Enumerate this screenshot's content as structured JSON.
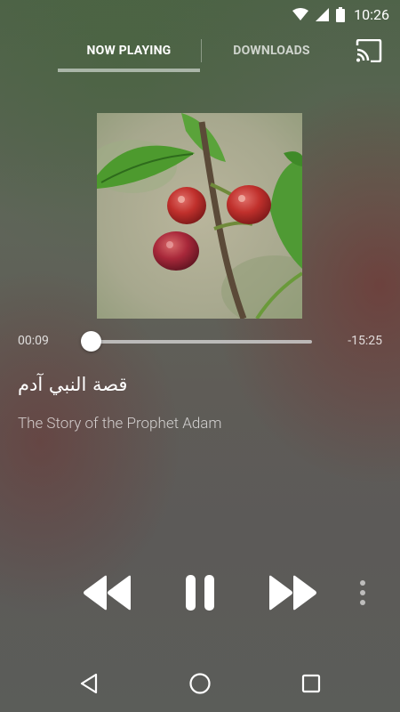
{
  "status_bar": {
    "time": "10:26",
    "icons": [
      "wifi-icon",
      "cell-signal-icon",
      "battery-icon"
    ]
  },
  "tabs": [
    {
      "label": "NOW PLAYING",
      "active": true
    },
    {
      "label": "DOWNLOADS",
      "active": false
    }
  ],
  "header": {
    "cast_icon": "cast-icon"
  },
  "player": {
    "elapsed": "00:09",
    "remaining": "-15:25",
    "progress_fraction": 0.01,
    "title_arabic": "قصة النبي آدم",
    "subtitle": "The Story of the Prophet Adam",
    "is_playing": true
  },
  "controls": {
    "icons": [
      "rewind-icon",
      "pause-icon",
      "fast-forward-icon",
      "more-vert-icon"
    ]
  },
  "nav_bar": {
    "icons": [
      "back-icon",
      "home-icon",
      "recents-icon"
    ]
  },
  "colors": {
    "accent_indicator": "#c8d2c8",
    "text_primary": "#ffffff"
  }
}
